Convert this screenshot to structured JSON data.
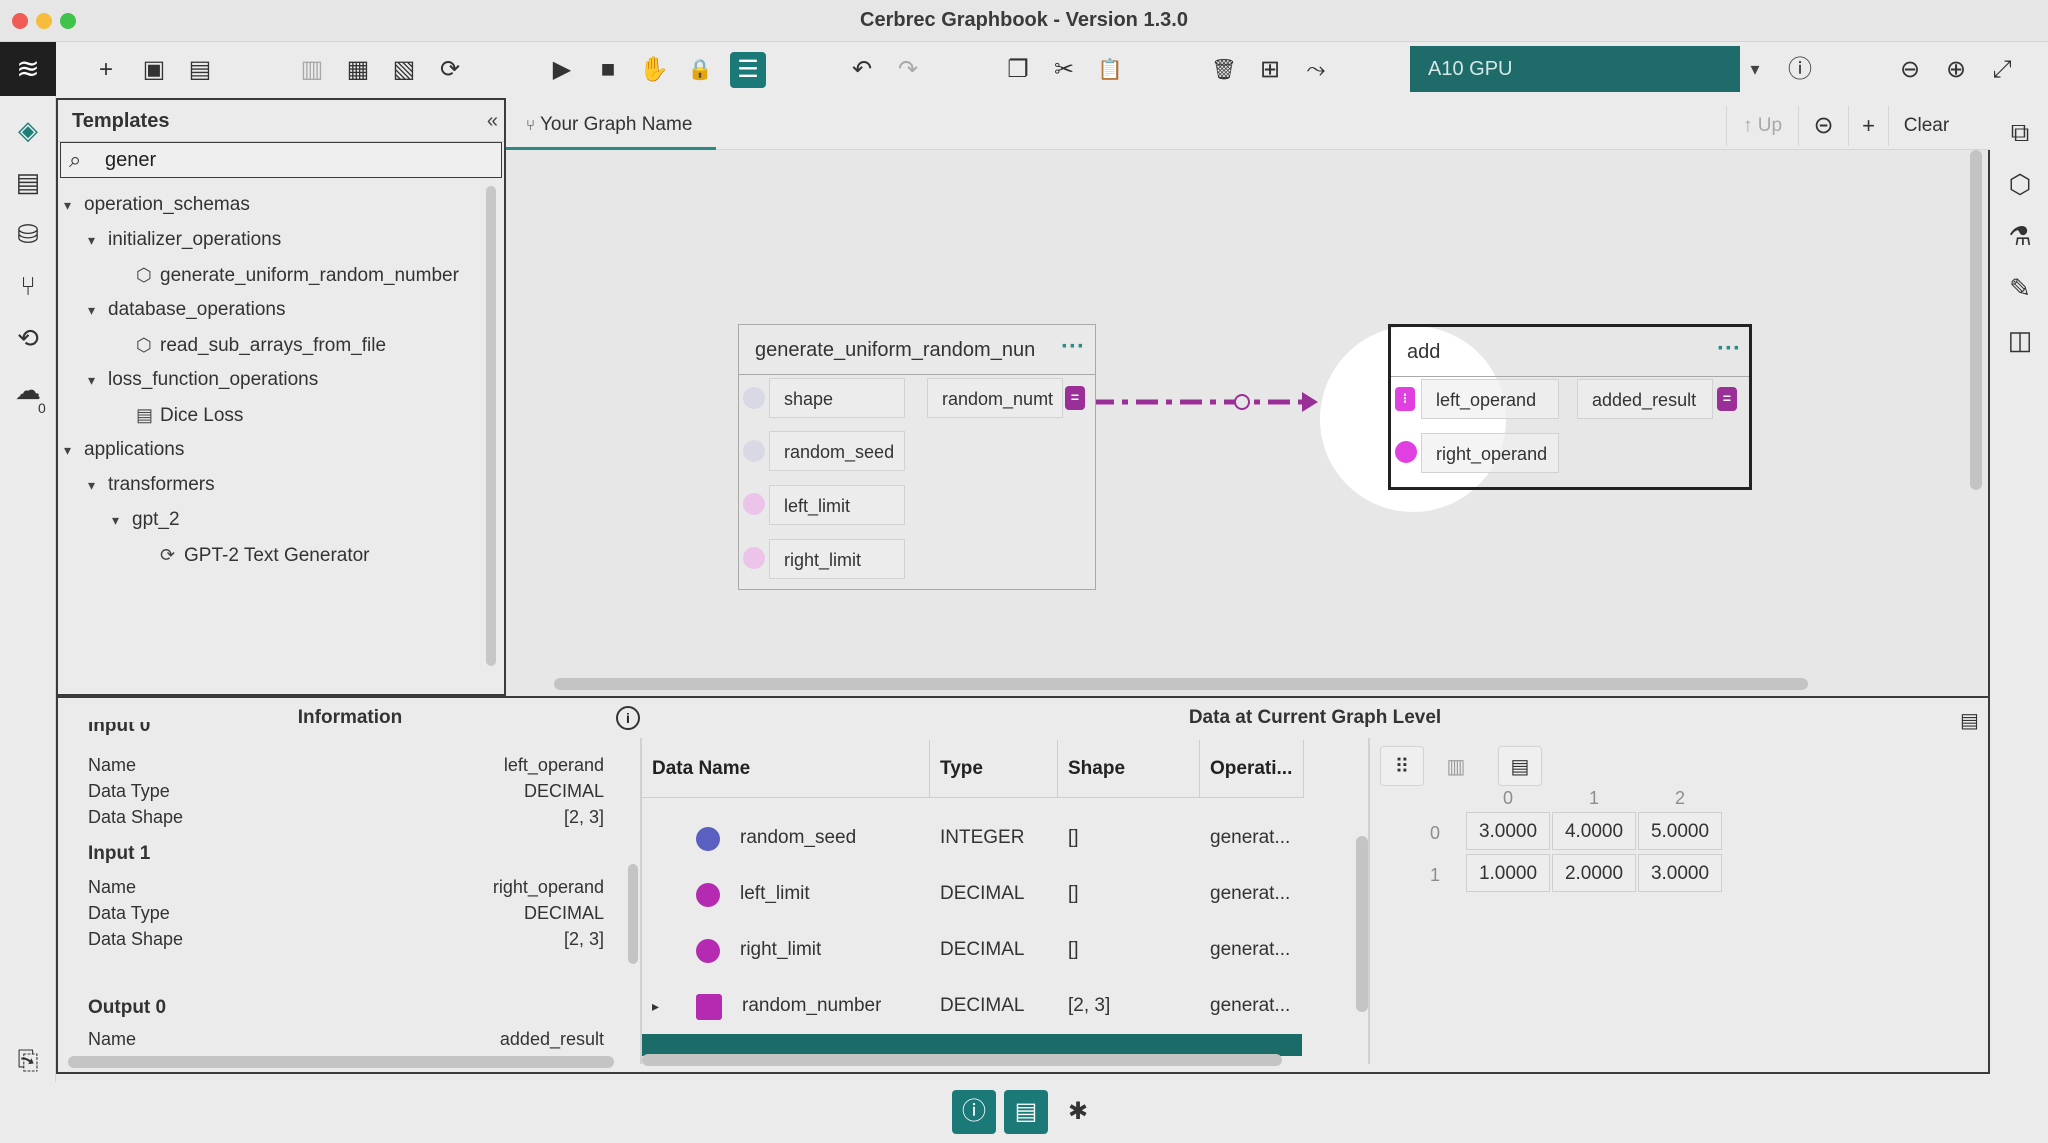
{
  "window": {
    "title": "Cerbrec Graphbook - Version 1.3.0"
  },
  "rail": {
    "logo": "≋",
    "icons": [
      "◈",
      "▤",
      "⛁",
      "⑂",
      "⟲",
      "☁"
    ],
    "badge": "0",
    "bottom_icon": "⎘"
  },
  "toolbar": {
    "icons": [
      "+",
      "▣",
      "▤",
      "▥",
      "▦",
      "▧",
      "⟳",
      "▶",
      "■",
      "✋",
      "🔒",
      "☰",
      "↶",
      "↷",
      "❐",
      "✂",
      "📋",
      "🗑",
      "⊞",
      "⤳"
    ],
    "gpu_label": "A10 GPU",
    "gpu_caret": "▾",
    "info_icon": "ⓘ",
    "zoom_out_icon": "⊖",
    "zoom_in_icon": "⊕",
    "fullscreen_icon": "⤢"
  },
  "templates": {
    "title": "Templates",
    "collapse": "«",
    "search_icon": "⌕",
    "search_value": "gener",
    "tree": [
      {
        "label": "operation_schemas",
        "caret": "▾",
        "icon": ""
      },
      {
        "label": "initializer_operations",
        "caret": "▾",
        "icon": ""
      },
      {
        "label": "generate_uniform_random_number",
        "caret": "",
        "icon": "⬡"
      },
      {
        "label": "database_operations",
        "caret": "▾",
        "icon": ""
      },
      {
        "label": "read_sub_arrays_from_file",
        "caret": "",
        "icon": "⬡"
      },
      {
        "label": "loss_function_operations",
        "caret": "▾",
        "icon": ""
      },
      {
        "label": "Dice Loss",
        "caret": "",
        "icon": "▤"
      },
      {
        "label": "applications",
        "caret": "▾",
        "icon": ""
      },
      {
        "label": "transformers",
        "caret": "▾",
        "icon": ""
      },
      {
        "label": "gpt_2",
        "caret": "▾",
        "icon": ""
      },
      {
        "label": "GPT-2 Text Generator",
        "caret": "",
        "icon": "⟳"
      }
    ]
  },
  "graph": {
    "tab_icon": "⑂",
    "tab_name": "Your Graph Name",
    "up_label": "↑ Up",
    "back_icon": "⊝",
    "add_label": "+",
    "clear_label": "Clear",
    "node1": {
      "title": "generate_uniform_random_nun",
      "menu": "···",
      "inputs": [
        "shape",
        "random_seed",
        "left_limit",
        "right_limit"
      ],
      "output": "random_numt",
      "out_symbol": "="
    },
    "node2": {
      "title": "add",
      "menu": "···",
      "inputs": [
        "left_operand",
        "right_operand"
      ],
      "output": "added_result",
      "in_symbol": "⁝",
      "out_symbol": "="
    }
  },
  "right_rail": {
    "icons": [
      "⧉",
      "⬡",
      "⚗",
      "✎",
      "◫"
    ]
  },
  "info": {
    "title": "Information",
    "icon": "i",
    "clipped_heading": "Input 0",
    "input0": {
      "name_k": "Name",
      "name_v": "left_operand",
      "type_k": "Data Type",
      "type_v": "DECIMAL",
      "shape_k": "Data Shape",
      "shape_v": "[2, 3]"
    },
    "input1": {
      "heading": "Input 1",
      "name_k": "Name",
      "name_v": "right_operand",
      "type_k": "Data Type",
      "type_v": "DECIMAL",
      "shape_k": "Data Shape",
      "shape_v": "[2, 3]"
    },
    "output0": {
      "heading": "Output 0",
      "name_k": "Name",
      "name_v": "added_result"
    }
  },
  "data_panel": {
    "title": "Data at Current Graph Level",
    "menu_icon": "▤",
    "columns": [
      "Data Name",
      "Type",
      "Shape",
      "Operati..."
    ],
    "rows": [
      {
        "name": "random_seed",
        "type": "INTEGER",
        "shape": "[]",
        "op": "generat...",
        "color": "#5a5fc0",
        "kind": "dot",
        "expander": ""
      },
      {
        "name": "left_limit",
        "type": "DECIMAL",
        "shape": "[]",
        "op": "generat...",
        "color": "#b42ab0",
        "kind": "dot",
        "expander": ""
      },
      {
        "name": "right_limit",
        "type": "DECIMAL",
        "shape": "[]",
        "op": "generat...",
        "color": "#b42ab0",
        "kind": "dot",
        "expander": ""
      },
      {
        "name": "random_number",
        "type": "DECIMAL",
        "shape": "[2, 3]",
        "op": "generat...",
        "color": "#b42ab0",
        "kind": "square",
        "expander": "▸"
      }
    ]
  },
  "viewer": {
    "buttons": [
      "⠿",
      "▥",
      "▤"
    ],
    "col_headers": [
      "0",
      "1",
      "2"
    ],
    "row_headers": [
      "0",
      "1"
    ],
    "values": [
      [
        "3.0000",
        "4.0000",
        "5.0000"
      ],
      [
        "1.0000",
        "2.0000",
        "3.0000"
      ]
    ]
  },
  "dock": {
    "icons": [
      "ⓘ",
      "▤",
      "✱"
    ]
  },
  "colors": {
    "accent": "#1b7a78",
    "port_magenta": "#c23fbf",
    "port_magenta_bright": "#e040e0",
    "edge": "#9b2f98"
  }
}
